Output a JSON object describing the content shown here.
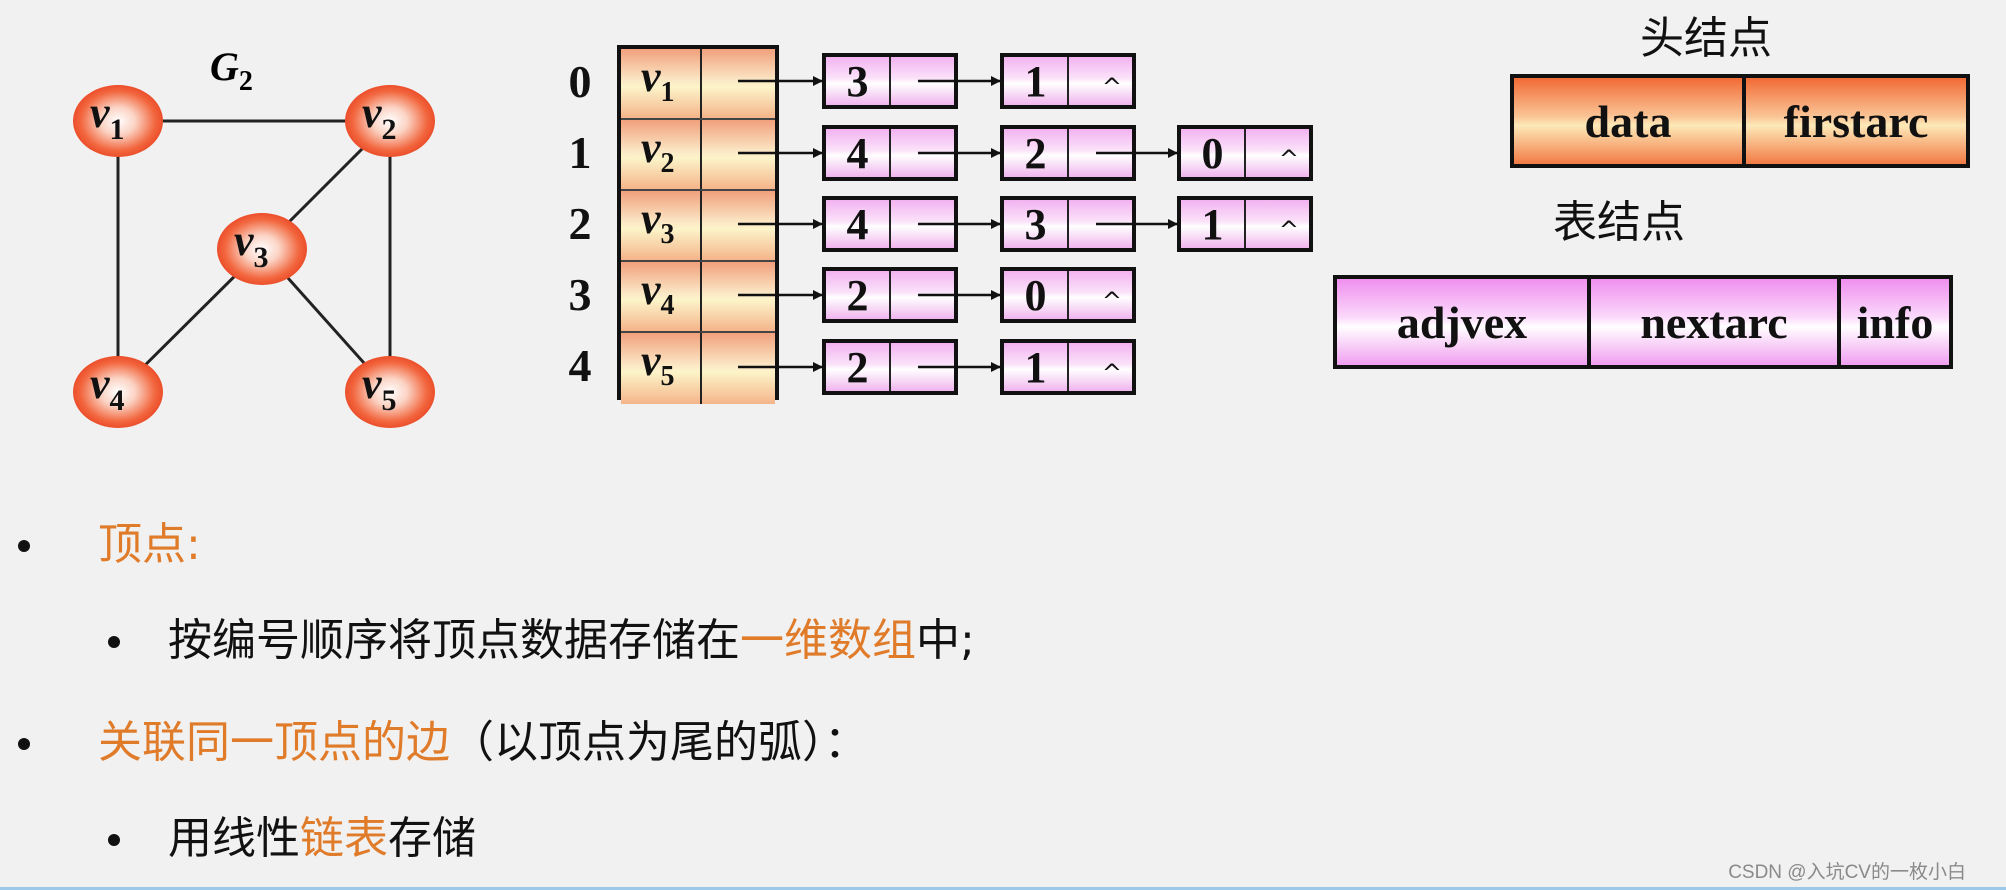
{
  "graph": {
    "title": "G",
    "title_sub": "2",
    "vertices": [
      {
        "id": "v1",
        "label": "v",
        "sub": "1"
      },
      {
        "id": "v2",
        "label": "v",
        "sub": "2"
      },
      {
        "id": "v3",
        "label": "v",
        "sub": "3"
      },
      {
        "id": "v4",
        "label": "v",
        "sub": "4"
      },
      {
        "id": "v5",
        "label": "v",
        "sub": "5"
      }
    ],
    "edges": [
      [
        "v1",
        "v2"
      ],
      [
        "v1",
        "v4"
      ],
      [
        "v2",
        "v3"
      ],
      [
        "v2",
        "v5"
      ],
      [
        "v3",
        "v4"
      ],
      [
        "v3",
        "v5"
      ]
    ],
    "node_color": "#ee4a2a"
  },
  "adjacency_list": {
    "indices": [
      "0",
      "1",
      "2",
      "3",
      "4"
    ],
    "head_nodes": [
      {
        "label": "v",
        "sub": "1"
      },
      {
        "label": "v",
        "sub": "2"
      },
      {
        "label": "v",
        "sub": "3"
      },
      {
        "label": "v",
        "sub": "4"
      },
      {
        "label": "v",
        "sub": "5"
      }
    ],
    "lists": [
      [
        "3",
        "1"
      ],
      [
        "4",
        "2",
        "0"
      ],
      [
        "4",
        "3",
        "1"
      ],
      [
        "2",
        "0"
      ],
      [
        "2",
        "1"
      ]
    ],
    "null_symbol": "^"
  },
  "legend": {
    "head_title": "头结点",
    "head_fields": [
      "data",
      "firstarc"
    ],
    "table_title": "表结点",
    "table_fields": [
      "adjvex",
      "nextarc",
      "info"
    ]
  },
  "bullets": {
    "b1": {
      "hl": "顶点",
      "rest": ":"
    },
    "b1_1": {
      "pre": "按编号顺序将顶点数据存储在",
      "hl": "一维数组",
      "post": "中;"
    },
    "b2": {
      "hl": "关联同一顶点的边",
      "rest": "（以顶点为尾的弧）："
    },
    "b2_1": {
      "pre": "用线性",
      "hl": "链表",
      "post": "存储"
    }
  },
  "colors": {
    "highlight": "#e07b2a",
    "text": "#111111"
  },
  "watermark": "CSDN @入坑CV的一枚小白"
}
